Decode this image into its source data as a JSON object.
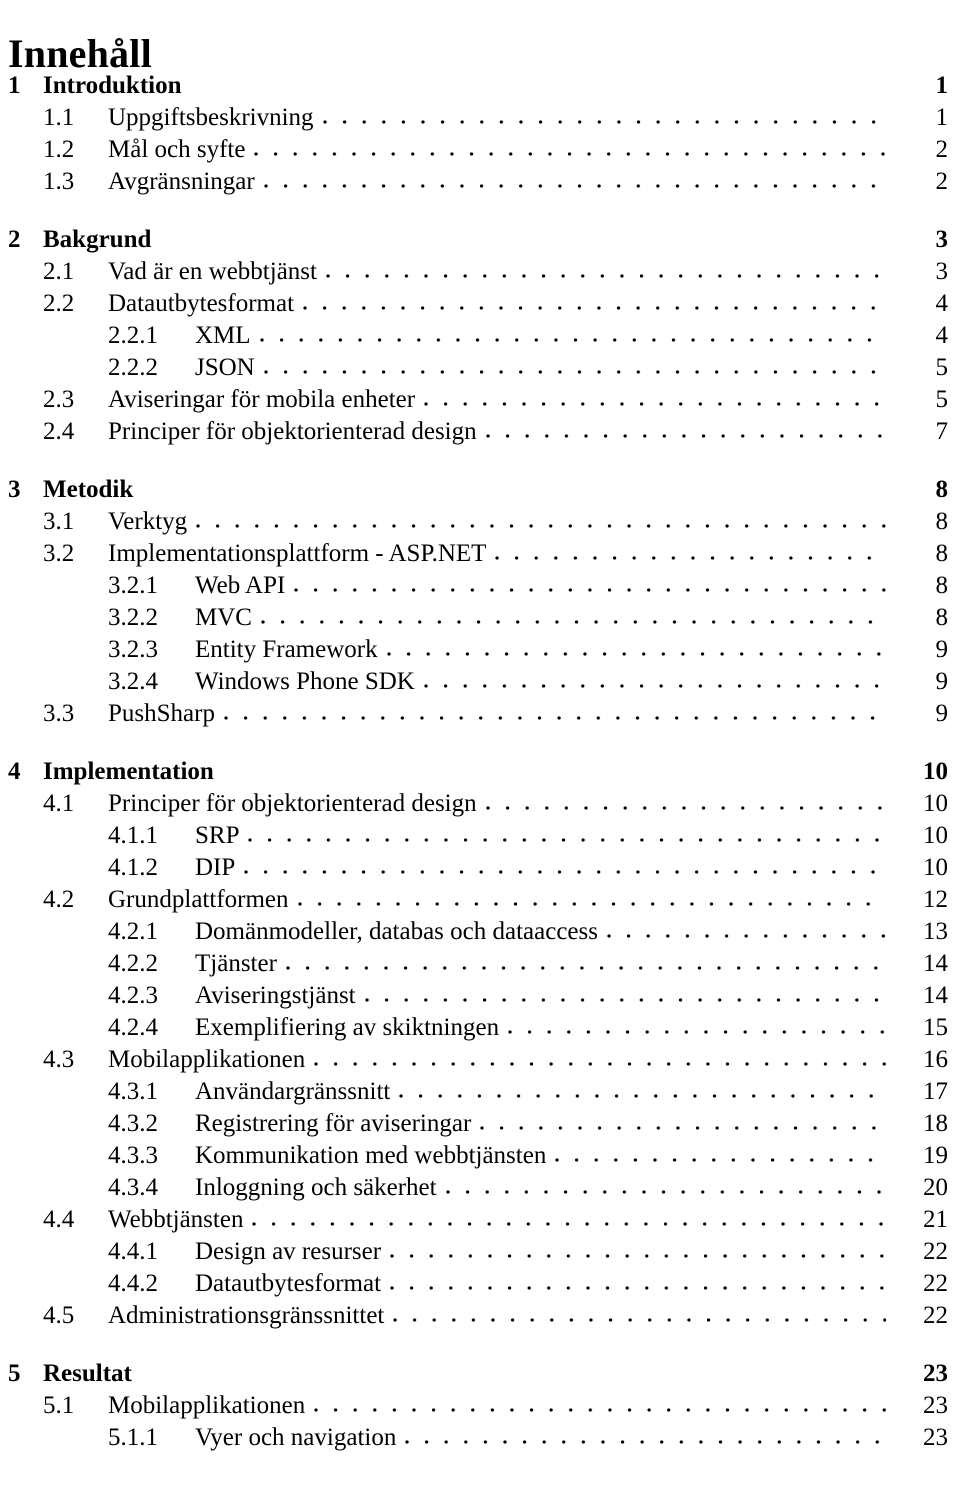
{
  "document": {
    "title": "Innehåll"
  },
  "toc": {
    "entries": [
      {
        "level": 1,
        "number": "1",
        "label": "Introduktion",
        "page": "1"
      },
      {
        "level": 2,
        "number": "1.1",
        "label": "Uppgiftsbeskrivning",
        "page": "1"
      },
      {
        "level": 2,
        "number": "1.2",
        "label": "Mål och syfte",
        "page": "2"
      },
      {
        "level": 2,
        "number": "1.3",
        "label": "Avgränsningar",
        "page": "2"
      },
      {
        "level": 1,
        "number": "2",
        "label": "Bakgrund",
        "page": "3"
      },
      {
        "level": 2,
        "number": "2.1",
        "label": "Vad är en webbtjänst",
        "page": "3"
      },
      {
        "level": 2,
        "number": "2.2",
        "label": "Datautbytesformat",
        "page": "4"
      },
      {
        "level": 3,
        "number": "2.2.1",
        "label": "XML",
        "page": "4"
      },
      {
        "level": 3,
        "number": "2.2.2",
        "label": "JSON",
        "page": "5"
      },
      {
        "level": 2,
        "number": "2.3",
        "label": "Aviseringar för mobila enheter",
        "page": "5"
      },
      {
        "level": 2,
        "number": "2.4",
        "label": "Principer för objektorienterad design",
        "page": "7"
      },
      {
        "level": 1,
        "number": "3",
        "label": "Metodik",
        "page": "8"
      },
      {
        "level": 2,
        "number": "3.1",
        "label": "Verktyg",
        "page": "8"
      },
      {
        "level": 2,
        "number": "3.2",
        "label": "Implementationsplattform - ASP.NET",
        "page": "8"
      },
      {
        "level": 3,
        "number": "3.2.1",
        "label": "Web API",
        "page": "8"
      },
      {
        "level": 3,
        "number": "3.2.2",
        "label": "MVC",
        "page": "8"
      },
      {
        "level": 3,
        "number": "3.2.3",
        "label": "Entity Framework",
        "page": "9"
      },
      {
        "level": 3,
        "number": "3.2.4",
        "label": "Windows Phone SDK",
        "page": "9"
      },
      {
        "level": 2,
        "number": "3.3",
        "label": "PushSharp",
        "page": "9"
      },
      {
        "level": 1,
        "number": "4",
        "label": "Implementation",
        "page": "10"
      },
      {
        "level": 2,
        "number": "4.1",
        "label": "Principer för objektorienterad design",
        "page": "10"
      },
      {
        "level": 3,
        "number": "4.1.1",
        "label": "SRP",
        "page": "10"
      },
      {
        "level": 3,
        "number": "4.1.2",
        "label": "DIP",
        "page": "10"
      },
      {
        "level": 2,
        "number": "4.2",
        "label": "Grundplattformen",
        "page": "12"
      },
      {
        "level": 3,
        "number": "4.2.1",
        "label": "Domänmodeller, databas och dataaccess",
        "page": "13"
      },
      {
        "level": 3,
        "number": "4.2.2",
        "label": "Tjänster",
        "page": "14"
      },
      {
        "level": 3,
        "number": "4.2.3",
        "label": "Aviseringstjänst",
        "page": "14"
      },
      {
        "level": 3,
        "number": "4.2.4",
        "label": "Exemplifiering av skiktningen",
        "page": "15"
      },
      {
        "level": 2,
        "number": "4.3",
        "label": "Mobilapplikationen",
        "page": "16"
      },
      {
        "level": 3,
        "number": "4.3.1",
        "label": "Användargränssnitt",
        "page": "17"
      },
      {
        "level": 3,
        "number": "4.3.2",
        "label": "Registrering för aviseringar",
        "page": "18"
      },
      {
        "level": 3,
        "number": "4.3.3",
        "label": "Kommunikation med webbtjänsten",
        "page": "19"
      },
      {
        "level": 3,
        "number": "4.3.4",
        "label": "Inloggning och säkerhet",
        "page": "20"
      },
      {
        "level": 2,
        "number": "4.4",
        "label": "Webbtjänsten",
        "page": "21"
      },
      {
        "level": 3,
        "number": "4.4.1",
        "label": "Design av resurser",
        "page": "22"
      },
      {
        "level": 3,
        "number": "4.4.2",
        "label": "Datautbytesformat",
        "page": "22"
      },
      {
        "level": 2,
        "number": "4.5",
        "label": "Administrationsgränssnittet",
        "page": "22"
      },
      {
        "level": 1,
        "number": "5",
        "label": "Resultat",
        "page": "23"
      },
      {
        "level": 2,
        "number": "5.1",
        "label": "Mobilapplikationen",
        "page": "23"
      },
      {
        "level": 3,
        "number": "5.1.1",
        "label": "Vyer och navigation",
        "page": "23"
      }
    ]
  }
}
